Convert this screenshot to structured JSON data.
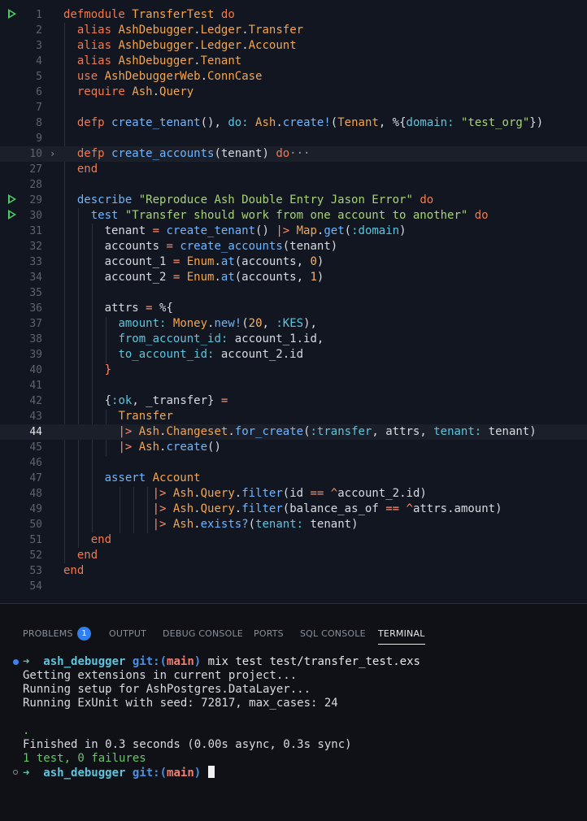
{
  "editor": {
    "lines": [
      {
        "n": "1",
        "text": "defmodule TransferTest do"
      },
      {
        "n": "2",
        "text": "  alias AshDebugger.Ledger.Transfer"
      },
      {
        "n": "3",
        "text": "  alias AshDebugger.Ledger.Account"
      },
      {
        "n": "4",
        "text": "  alias AshDebugger.Tenant"
      },
      {
        "n": "5",
        "text": "  use AshDebuggerWeb.ConnCase"
      },
      {
        "n": "6",
        "text": "  require Ash.Query"
      },
      {
        "n": "7",
        "text": ""
      },
      {
        "n": "8",
        "text": "  defp create_tenant(), do: Ash.create!(Tenant, %{domain: \"test_org\"})"
      },
      {
        "n": "9",
        "text": ""
      },
      {
        "n": "10",
        "text": "  defp create_accounts(tenant) do···"
      },
      {
        "n": "27",
        "text": "  end"
      },
      {
        "n": "28",
        "text": ""
      },
      {
        "n": "29",
        "text": "  describe \"Reproduce Ash Double Entry Jason Error\" do"
      },
      {
        "n": "30",
        "text": "    test \"Transfer should work from one account to another\" do"
      },
      {
        "n": "31",
        "text": "      tenant = create_tenant() |> Map.get(:domain)"
      },
      {
        "n": "32",
        "text": "      accounts = create_accounts(tenant)"
      },
      {
        "n": "33",
        "text": "      account_1 = Enum.at(accounts, 0)"
      },
      {
        "n": "34",
        "text": "      account_2 = Enum.at(accounts, 1)"
      },
      {
        "n": "35",
        "text": ""
      },
      {
        "n": "36",
        "text": "      attrs = %{"
      },
      {
        "n": "37",
        "text": "        amount: Money.new!(20, :KES),"
      },
      {
        "n": "38",
        "text": "        from_account_id: account_1.id,"
      },
      {
        "n": "39",
        "text": "        to_account_id: account_2.id"
      },
      {
        "n": "40",
        "text": "      }"
      },
      {
        "n": "41",
        "text": ""
      },
      {
        "n": "42",
        "text": "      {:ok, _transfer} ="
      },
      {
        "n": "43",
        "text": "        Transfer"
      },
      {
        "n": "44",
        "text": "        |> Ash.Changeset.for_create(:transfer, attrs, tenant: tenant)"
      },
      {
        "n": "45",
        "text": "        |> Ash.create()"
      },
      {
        "n": "46",
        "text": ""
      },
      {
        "n": "47",
        "text": "      assert Account"
      },
      {
        "n": "48",
        "text": "             |> Ash.Query.filter(id == ^account_2.id)"
      },
      {
        "n": "49",
        "text": "             |> Ash.Query.filter(balance_as_of == ^attrs.amount)"
      },
      {
        "n": "50",
        "text": "             |> Ash.exists?(tenant: tenant)"
      },
      {
        "n": "51",
        "text": "    end"
      },
      {
        "n": "52",
        "text": "  end"
      },
      {
        "n": "53",
        "text": "end"
      },
      {
        "n": "54",
        "text": ""
      }
    ]
  },
  "panel": {
    "tabs": [
      "PROBLEMS",
      "OUTPUT",
      "DEBUG CONSOLE",
      "PORTS",
      "SQL CONSOLE",
      "TERMINAL"
    ],
    "problems_count": "1",
    "active_tab": "TERMINAL"
  },
  "terminal": {
    "prompt_arrow": "➜",
    "cwd": "ash_debugger",
    "git_label": "git:(",
    "branch": "main",
    "git_close": ")",
    "command": "mix test test/transfer_test.exs",
    "output": [
      "Getting extensions in current project...",
      "Running setup for AshPostgres.DataLayer...",
      "Running ExUnit with seed: 72817, max_cases: 24",
      "",
      ".",
      "Finished in 0.3 seconds (0.00s async, 0.3s sync)"
    ],
    "result": "1 test, 0 failures"
  },
  "colors": {
    "keyword": "#f0794f",
    "module": "#f3a54f",
    "function": "#6fb5ff",
    "string": "#a8d27a",
    "atom": "#5ec4dc",
    "run": "#4ec96a",
    "badge": "#2f7ff0"
  }
}
